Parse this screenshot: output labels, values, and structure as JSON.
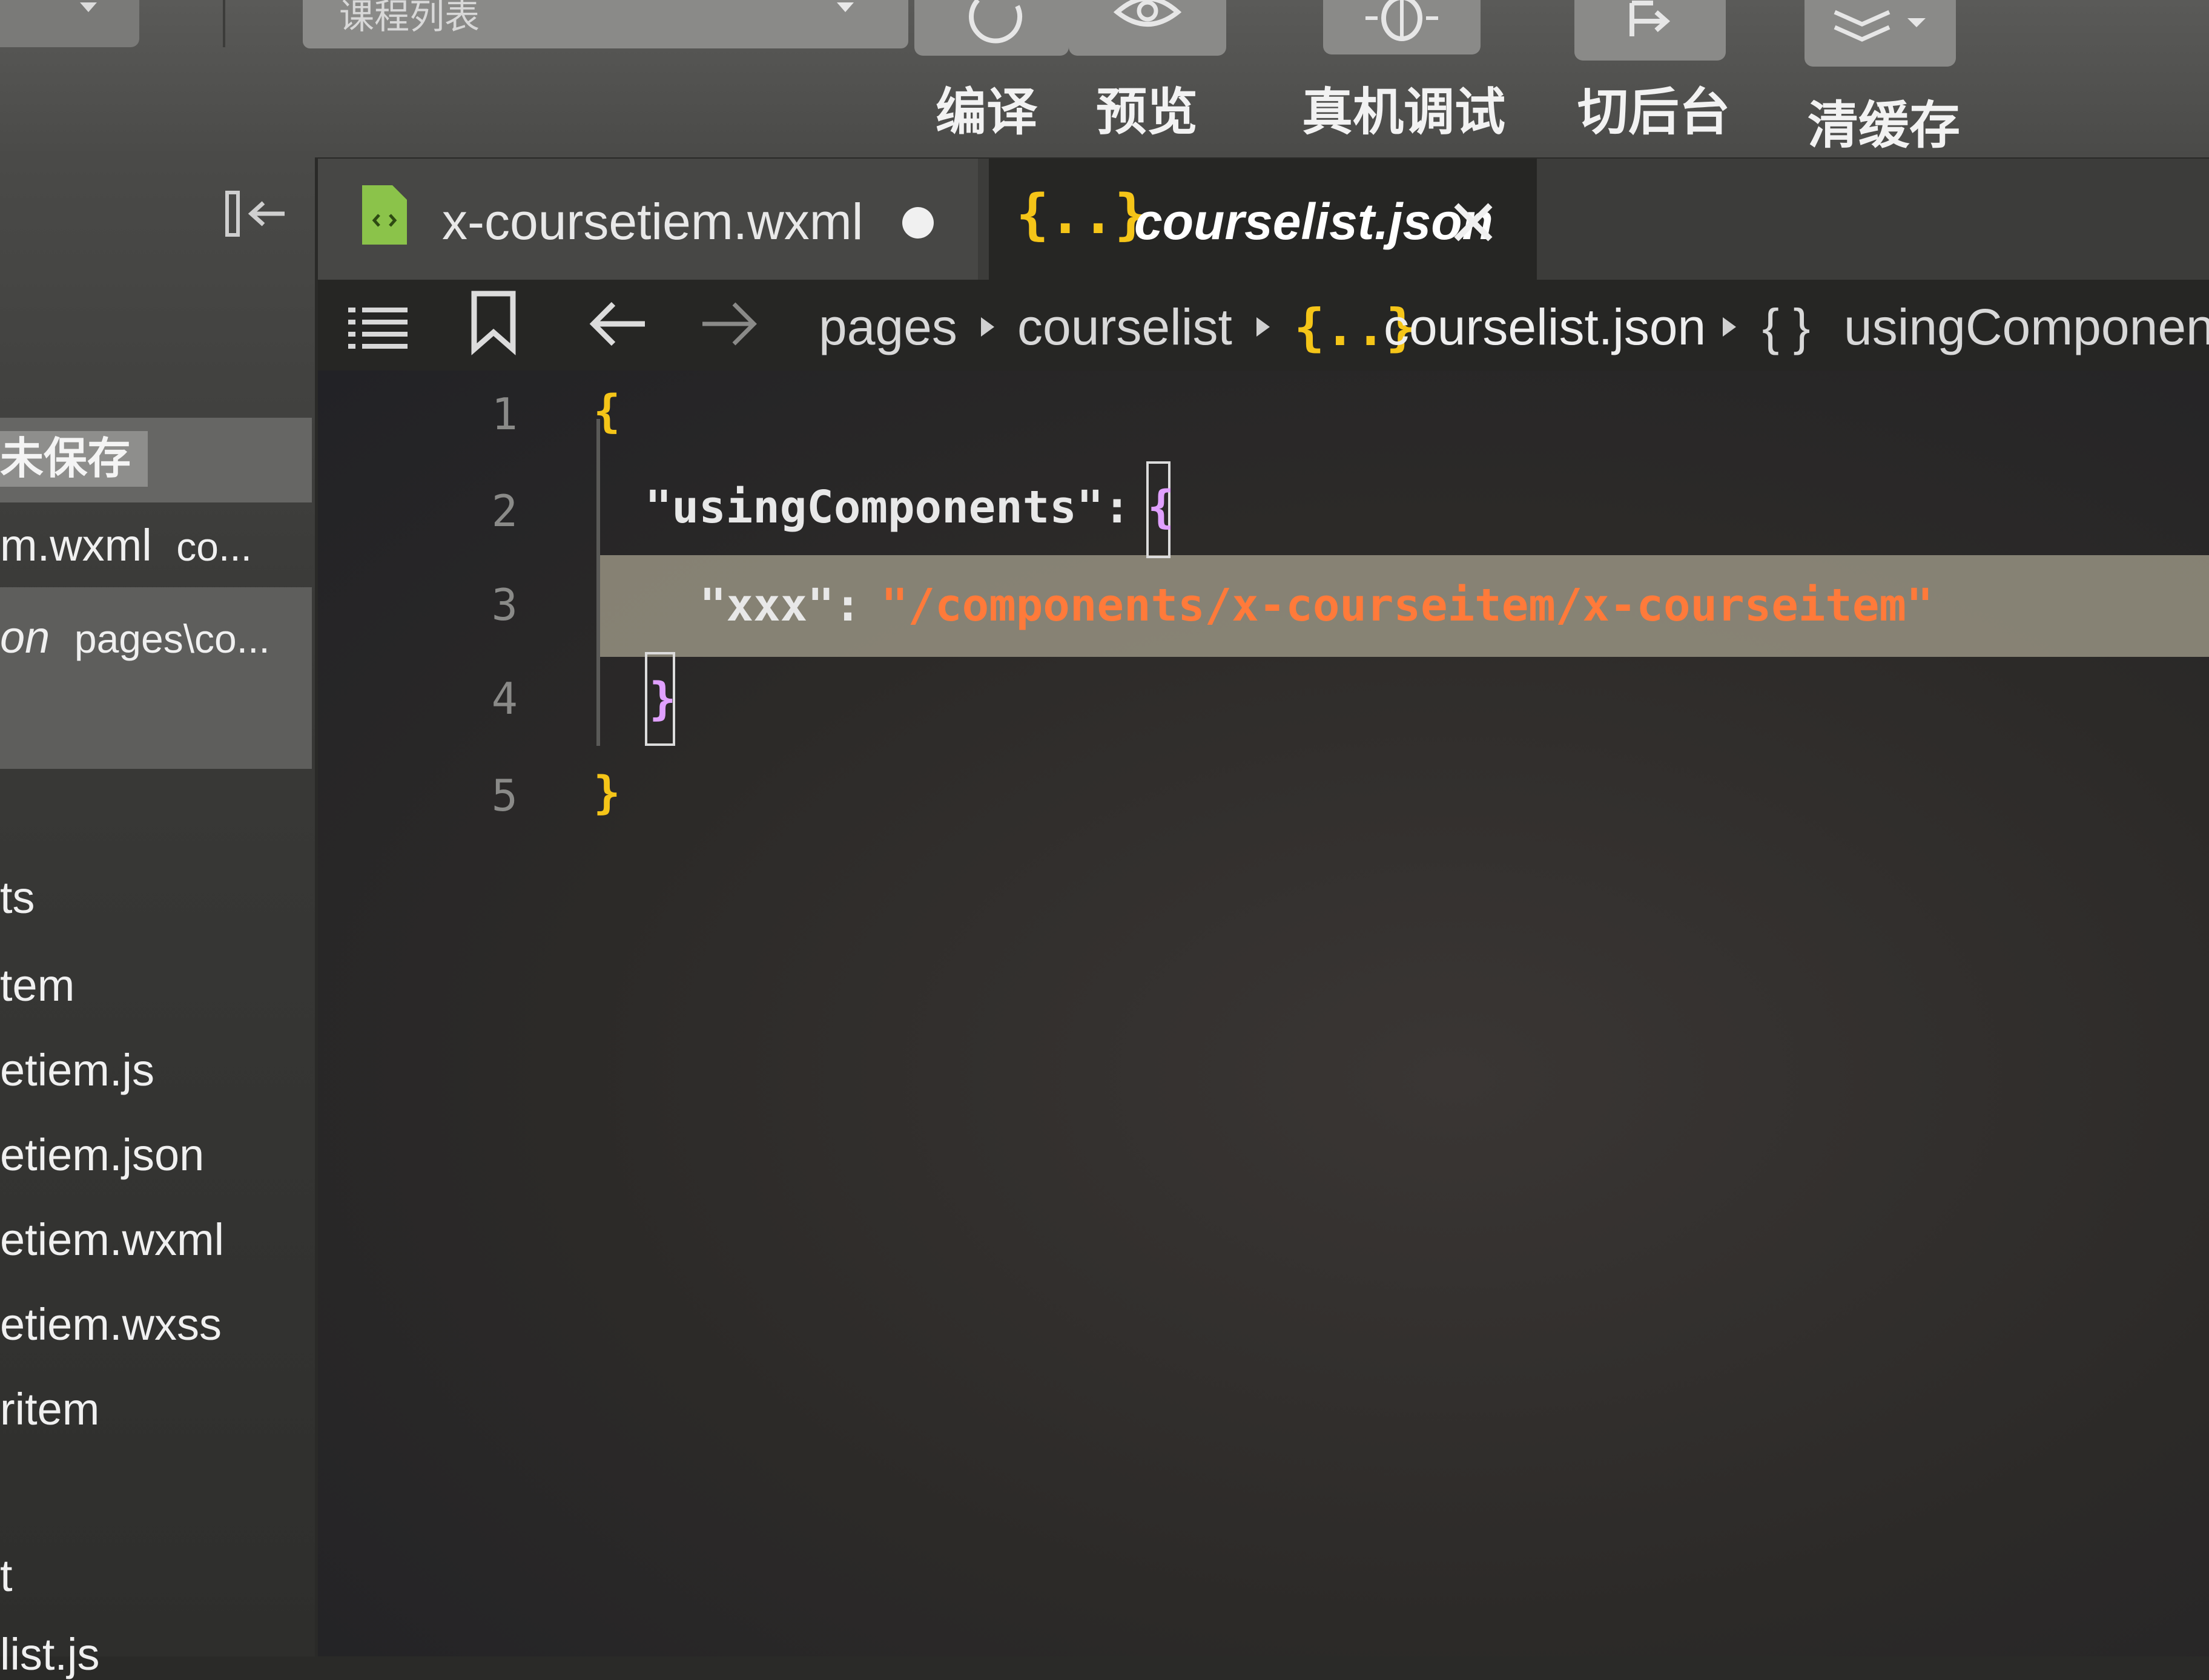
{
  "toolbar": {
    "mode_select": "课程列表",
    "buttons": [
      {
        "label": "编译",
        "icon": "refresh-icon"
      },
      {
        "label": "预览",
        "icon": "eye-icon"
      },
      {
        "label": "真机调试",
        "icon": "bug-icon"
      },
      {
        "label": "切后台",
        "icon": "switch-background-icon"
      },
      {
        "label": "清缓存",
        "icon": "layers-icon"
      }
    ]
  },
  "sidebar": {
    "open_editors_badge": "未保存",
    "open_files": [
      {
        "name": "m.wxml",
        "path": "co..."
      },
      {
        "name": "on",
        "path": "pages\\co..."
      }
    ],
    "tree": [
      "ts",
      "tem",
      "etiem.js",
      "etiem.json",
      "etiem.wxml",
      "etiem.wxss",
      "ritem",
      "t",
      "list.js"
    ]
  },
  "tabs": [
    {
      "label": "x-coursetiem.wxml",
      "status": "unsaved-dot",
      "icon": "wxml-file-icon"
    },
    {
      "label": "courselist.json",
      "status": "close",
      "icon": "json-file-icon",
      "active": true
    }
  ],
  "breadcrumb": {
    "items": [
      "pages",
      "courselist",
      "courselist.json",
      "usingComponent"
    ],
    "json_glyph": "{..}",
    "object_glyph": "{ }"
  },
  "editor": {
    "line_numbers": [
      "1",
      "2",
      "3",
      "4",
      "5"
    ],
    "lines": {
      "l1": "{",
      "l2_key": "\"usingComponents\":",
      "l2_brace": "{",
      "l3_key": "\"xxx\":",
      "l3_value": "\"/components/x-courseitem/x-courseitem\"",
      "l4": "}",
      "l5": "}"
    }
  },
  "colors": {
    "brace": "#f5c518",
    "string_value": "#ff7a3a",
    "json_icon": "#f5c518",
    "wxml_icon": "#8bc34a"
  }
}
